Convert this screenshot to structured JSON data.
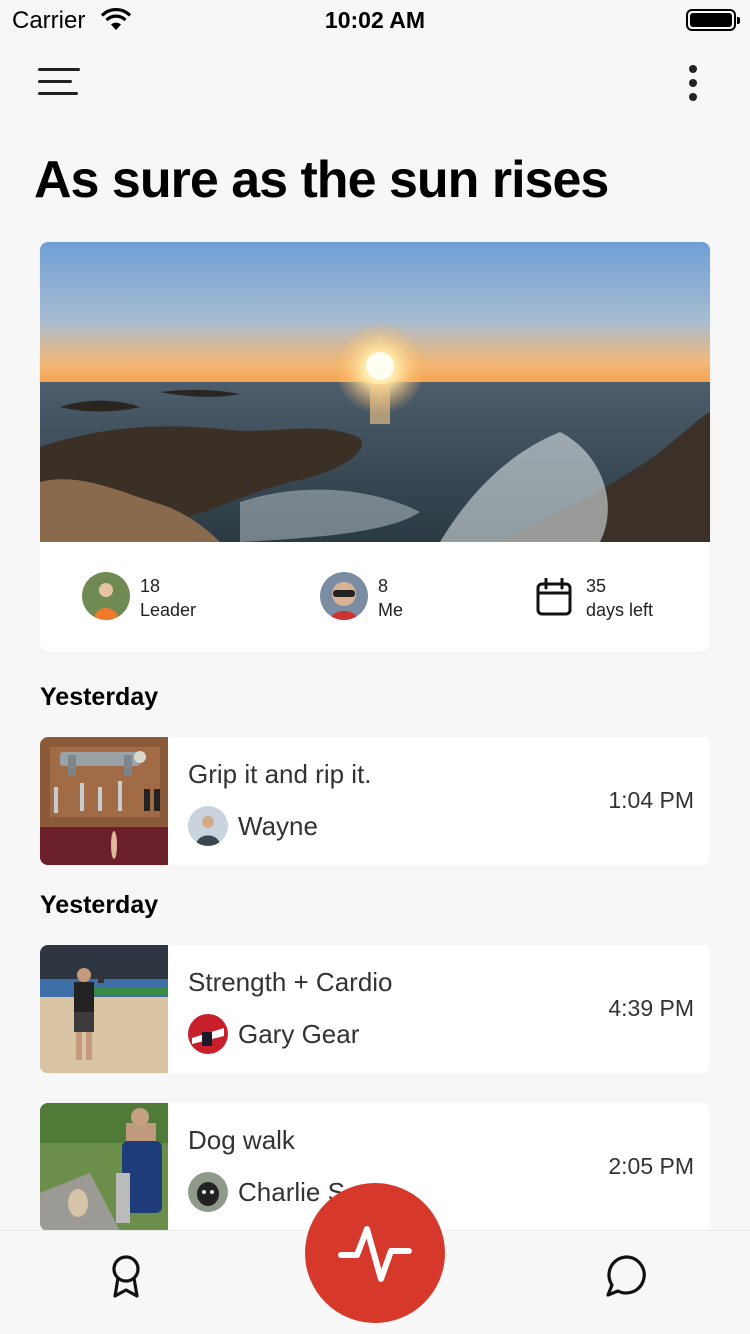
{
  "status_bar": {
    "carrier": "Carrier",
    "time": "10:02 AM"
  },
  "page": {
    "title": "As sure as the sun rises"
  },
  "challenge": {
    "stats": [
      {
        "value": "18",
        "label": "Leader"
      },
      {
        "value": "8",
        "label": "Me"
      },
      {
        "value": "35",
        "label": "days left",
        "icon": "calendar-icon"
      }
    ]
  },
  "feed": [
    {
      "section": "Yesterday",
      "title": "Grip it and rip it.",
      "user": "Wayne",
      "time": "1:04 PM"
    },
    {
      "section": "Yesterday",
      "title": "Strength + Cardio",
      "user": "Gary Gear",
      "time": "4:39 PM"
    },
    {
      "section": "",
      "title": "Dog walk",
      "user": "Charlie S",
      "time": "2:05 PM"
    }
  ],
  "tab_bar": {
    "left_icon": "award-icon",
    "center_icon": "activity-pulse-icon",
    "right_icon": "chat-bubble-icon"
  },
  "colors": {
    "accent": "#d6392b",
    "background": "#f7f7f7",
    "card": "#ffffff"
  }
}
